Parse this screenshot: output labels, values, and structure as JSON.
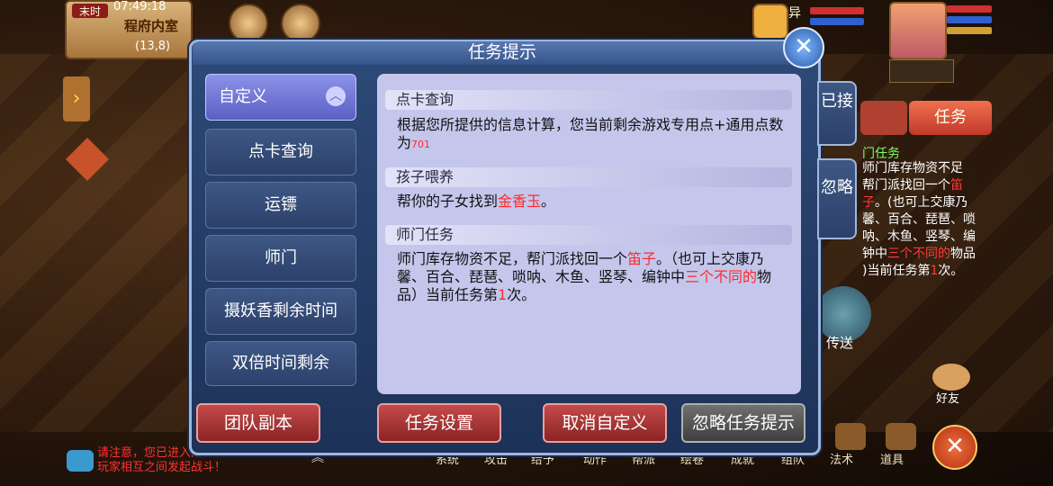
{
  "hud": {
    "period": "末时",
    "clock": "07:49:18",
    "location": "程府内室",
    "coords": "(13,8)",
    "pet_name": "异",
    "tabs": {
      "task": "任务"
    },
    "bg_task": {
      "title": "门任务",
      "line1": "师门库存物资不足",
      "line2_a": "帮门派找回一个",
      "line2_b": "笛",
      "line3_a": "子",
      "line3_b": "。(也可上交康乃",
      "line4": "馨、百合、琵琶、唢",
      "line5": "呐、木鱼、竖琴、编",
      "line6_a": "钟中",
      "line6_b": "三个不同的",
      "line6_c": "物品",
      "line7_a": ")当前任务第",
      "line7_b": "1",
      "line7_c": "次。"
    },
    "teleport": "传送",
    "friend": "好友",
    "chat": "请注意，您已进入战斗区域！此区域允许玩家相互之间发起战斗！",
    "bottom_menu": [
      "系统",
      "攻击",
      "给予",
      "动作",
      "帮派",
      "绘卷",
      "成就",
      "组队",
      "法术",
      "道具"
    ]
  },
  "dialog": {
    "title": "任务提示",
    "side_tabs": {
      "accepted": "已接",
      "ignored": "忽略"
    },
    "categories": [
      "自定义",
      "点卡查询",
      "运镖",
      "师门",
      "摄妖香剩余时间",
      "双倍时间剩余"
    ],
    "sections": [
      {
        "head": "点卡查询",
        "body_a": "根据您所提供的信息计算，您当前剩余游戏专用点+通用点数为",
        "body_hl": "701"
      },
      {
        "head": "孩子喂养",
        "body_a": "帮你的子女找到",
        "body_hl": "金香玉",
        "body_b": "。"
      },
      {
        "head": "师门任务",
        "body_a": "师门库存物资不足，帮门派找回一个",
        "body_hl": "笛子",
        "body_b": "。（也可上交康乃馨、百合、琵琶、唢呐、木鱼、竖琴、编钟中",
        "body_hl2": "三个不同的",
        "body_c": "物品）当前任务第",
        "body_hl3": "1",
        "body_d": "次。"
      }
    ],
    "buttons": {
      "team_dungeon": "团队副本",
      "task_settings": "任务设置",
      "cancel_custom": "取消自定义",
      "ignore_prompt": "忽略任务提示"
    }
  },
  "colors": {
    "highlight": "#ff2a2a",
    "active_tab": "#7a7fe0",
    "content_bg": "#c5c6ec"
  }
}
